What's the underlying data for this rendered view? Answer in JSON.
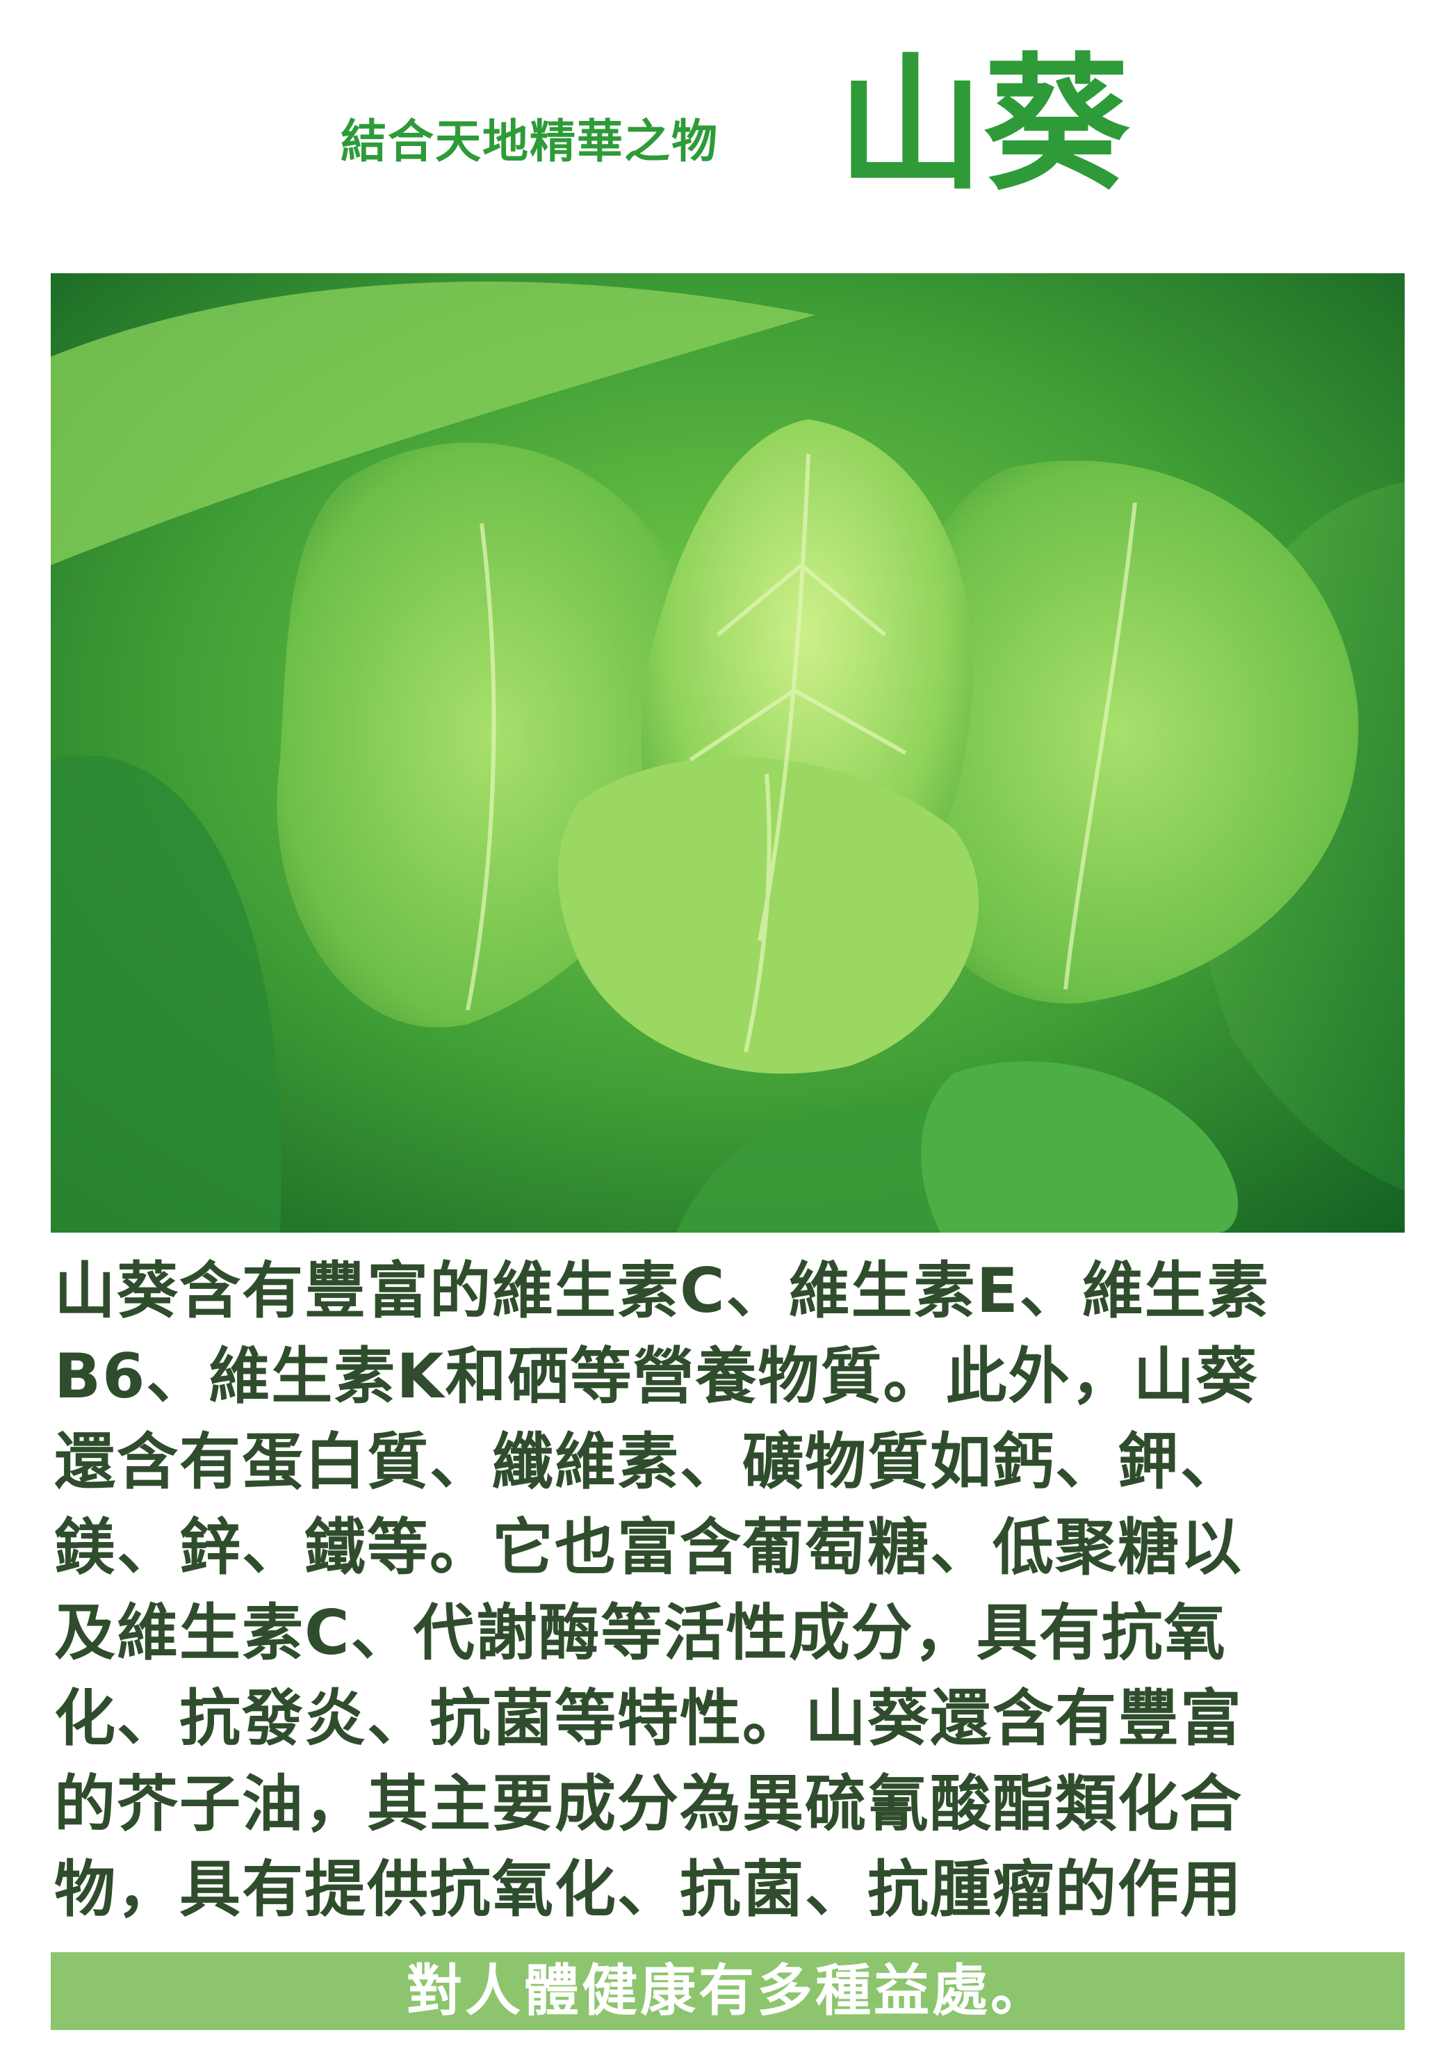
{
  "header": {
    "tagline": "結合天地精華之物",
    "title": "山葵"
  },
  "photo": {
    "subject": "wasabi-leaves-photo"
  },
  "body": {
    "lines": [
      "山葵含有豐富的維生素C、維生素E、維生素",
      "B6、維生素K和硒等營養物質。此外，山葵",
      "還含有蛋白質、纖維素、礦物質如鈣、鉀、",
      "鎂、鋅、鐵等。它也富含葡萄糖、低聚糖以",
      "及維生素C、代謝酶等活性成分，具有抗氧",
      "化、抗發炎、抗菌等特性。山葵還含有豐富",
      "的芥子油，其主要成分為異硫氰酸酯類化合",
      "物，具有提供抗氧化、抗菌、抗腫瘤的作用"
    ]
  },
  "footer": {
    "band_text": "對人體健康有多種益處。"
  },
  "colors": {
    "title_green": "#2e9b38",
    "body_text": "#2f4d2c",
    "band_green": "#8cc56e"
  }
}
